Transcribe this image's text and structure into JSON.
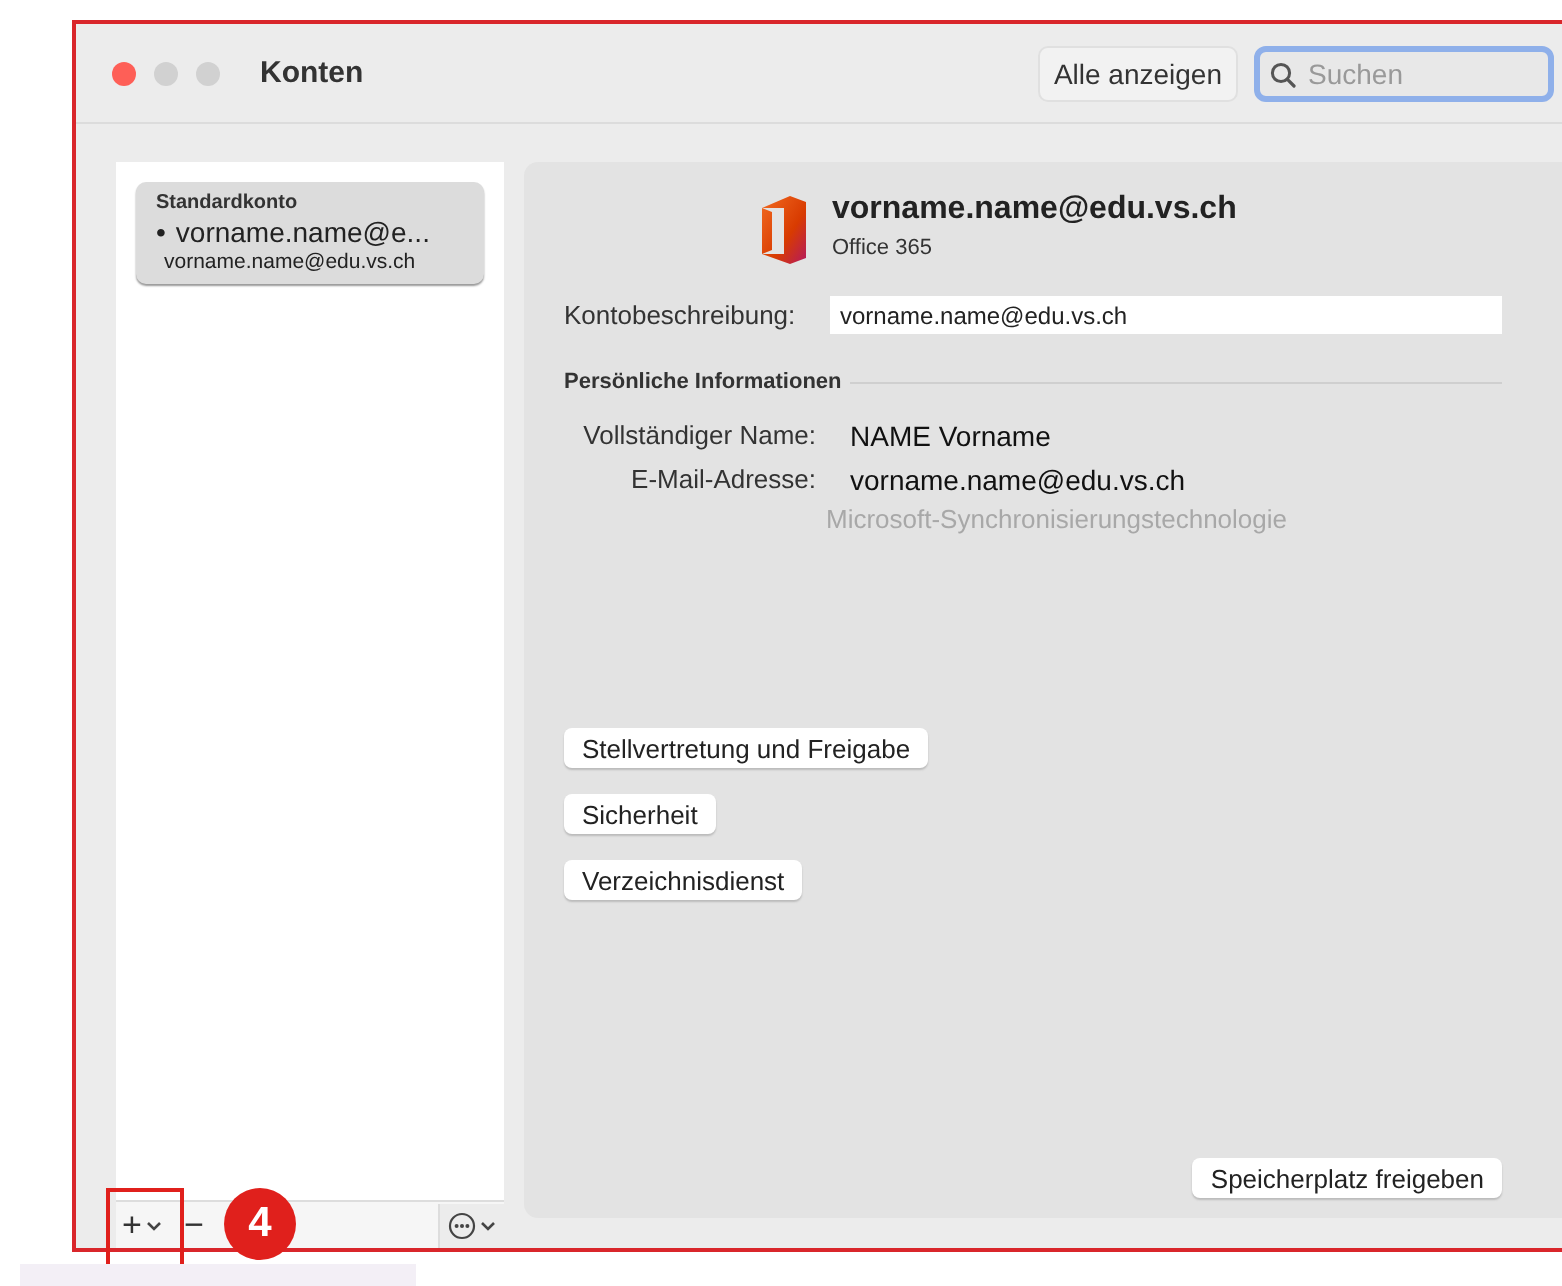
{
  "window": {
    "title": "Konten"
  },
  "toolbar": {
    "show_all_button": "Alle anzeigen",
    "search": {
      "placeholder": "Suchen",
      "focused": true
    }
  },
  "sidebar": {
    "accounts": [
      {
        "header": "Standardkonto",
        "bullet": "•",
        "name": "vorname.name@e...",
        "address": "vorname.name@edu.vs.ch",
        "selected": true
      }
    ],
    "add_button": "+",
    "remove_button": "−"
  },
  "account": {
    "title": "vorname.name@edu.vs.ch",
    "type": "Office 365",
    "description_label": "Kontobeschreibung:",
    "description_value": "vorname.name@edu.vs.ch",
    "section": "Persönliche Informationen",
    "fields": [
      {
        "label": "Vollständiger Name:",
        "value": "NAME Vorname"
      },
      {
        "label": "E-Mail-Adresse:",
        "value": "vorname.name@edu.vs.ch"
      }
    ],
    "note": "Microsoft-Synchronisierungstechnologie",
    "buttons": [
      "Stellvertretung und Freigabe",
      "Sicherheit",
      "Verzeichnisdienst"
    ],
    "storage_button": "Speicherplatz freigeben"
  },
  "annotation": {
    "step": "4"
  }
}
